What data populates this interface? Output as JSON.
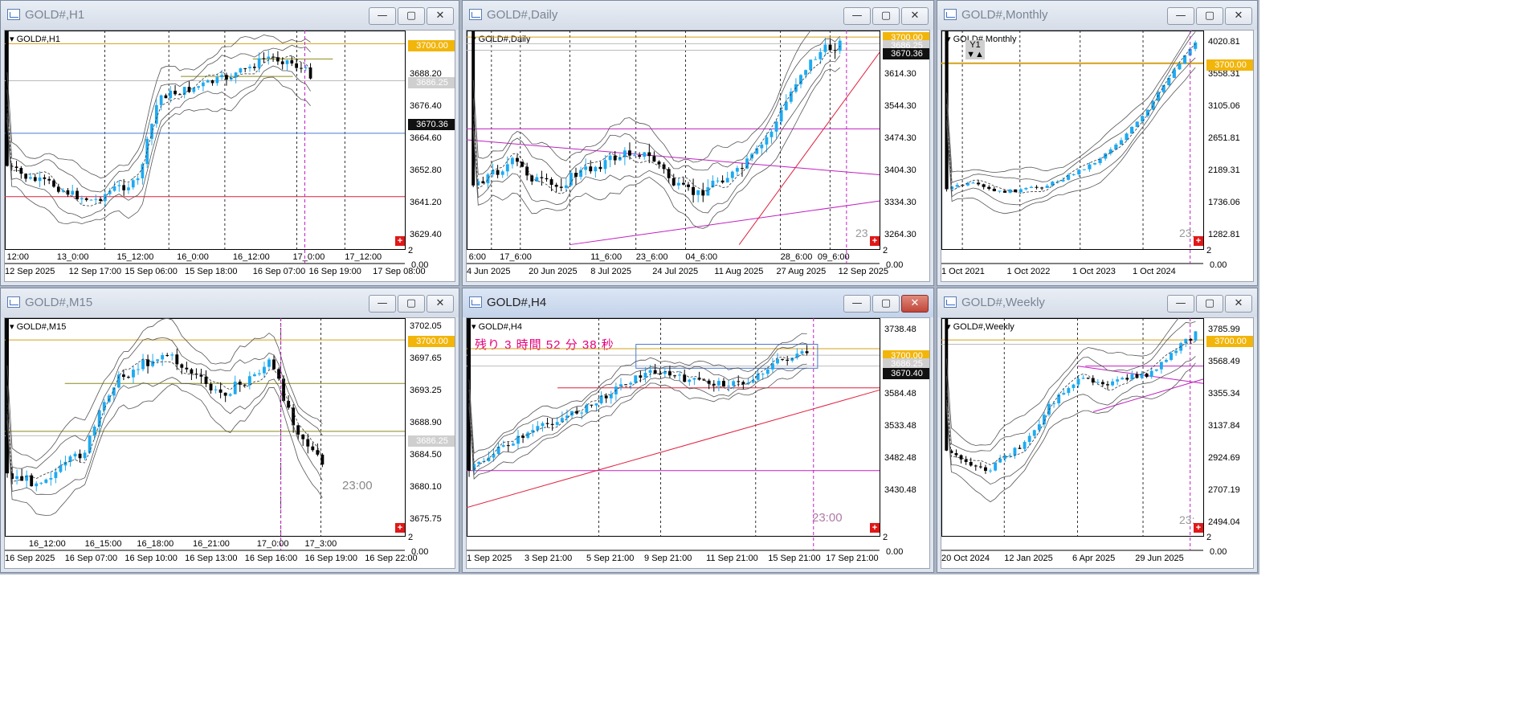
{
  "colors": {
    "gold_line": "#d4a017",
    "blue_line": "#4a7ad0",
    "magenta": "#c020c0",
    "red": "#e0203c",
    "olive": "#8a8a1a",
    "bull": "#1eaaf1",
    "bear": "#000000"
  },
  "windows": {
    "h1": {
      "title": "GOLD#,H1",
      "symbol_label": "GOLD#,H1",
      "price_labels": [
        "3688.20",
        "3676.40",
        "3664.60",
        "3652.80",
        "3641.20",
        "3629.40"
      ],
      "badges": [
        "3700.00",
        "3686.25",
        "3670.36"
      ],
      "scale_corner": "2",
      "scale_zero": "0.00",
      "top_times": [
        "12:00",
        "13_0:00",
        "15_12:00",
        "16_0:00",
        "16_12:00",
        "17_0:00",
        "17_12:00"
      ],
      "bottom_dates": [
        "12 Sep 2025",
        "12 Sep 17:00",
        "15 Sep 06:00",
        "15 Sep 18:00",
        "16 Sep 07:00",
        "16 Sep 19:00",
        "17 Sep 08:00"
      ]
    },
    "daily": {
      "title": "GOLD#,Daily",
      "symbol_label": "GOLD#,Daily",
      "price_labels": [
        "3614.30",
        "3544.30",
        "3474.30",
        "3404.30",
        "3334.30",
        "3264.30"
      ],
      "badges": [
        "3700.00",
        "3686.25",
        "3670.36"
      ],
      "scale_corner": "2",
      "scale_zero": "0.00",
      "timer_stub": "23",
      "top_times": [
        "6:00",
        "17_6:00",
        "11_6:00",
        "23_6:00",
        "04_6:00",
        "28_6:00",
        "09_6:00"
      ],
      "bottom_dates": [
        "4 Jun 2025",
        "20 Jun 2025",
        "8 Jul 2025",
        "24 Jul 2025",
        "11 Aug 2025",
        "27 Aug 2025",
        "12 Sep 2025"
      ]
    },
    "monthly": {
      "title": "GOLD#,Monthly",
      "symbol_label": "GOLD#,Monthly",
      "period_tag": "Y1",
      "arrows": "▼▲",
      "price_labels": [
        "4020.81",
        "3558.31",
        "3105.06",
        "2651.81",
        "2189.31",
        "1736.06",
        "1282.81"
      ],
      "badges": [
        "3700.00"
      ],
      "scale_corner": "2",
      "scale_zero": "0.00",
      "timer_stub": "23:",
      "bottom_dates": [
        "1 Oct 2021",
        "1 Oct 2022",
        "1 Oct 2023",
        "1 Oct 2024"
      ]
    },
    "m15": {
      "title": "GOLD#,M15",
      "symbol_label": "GOLD#,M15",
      "price_labels": [
        "3702.05",
        "3697.65",
        "3693.25",
        "3688.90",
        "3684.50",
        "3680.10",
        "3675.75"
      ],
      "badges": [
        "3700.00",
        "3686.25"
      ],
      "scale_corner": "2",
      "scale_zero": "0.00",
      "timer": "23:00",
      "top_times": [
        "16_12:00",
        "16_15:00",
        "16_18:00",
        "16_21:00",
        "17_0:00",
        "17_3:00"
      ],
      "bottom_dates": [
        "16 Sep 2025",
        "16 Sep 07:00",
        "16 Sep 10:00",
        "16 Sep 13:00",
        "16 Sep 16:00",
        "16 Sep 19:00",
        "16 Sep 22:00"
      ]
    },
    "h4": {
      "title": "GOLD#,H4",
      "symbol_label": "GOLD#,H4",
      "countdown": "残り 3 時間 52 分 38 秒",
      "price_labels": [
        "3738.48",
        "3636.48",
        "3584.48",
        "3533.48",
        "3482.48",
        "3430.48"
      ],
      "badges": [
        "3700.00",
        "3686.25",
        "3670.40"
      ],
      "scale_corner": "2",
      "scale_zero": "0.00",
      "timer": "23:00",
      "bottom_dates": [
        "1 Sep 2025",
        "3 Sep 21:00",
        "5 Sep 21:00",
        "9 Sep 21:00",
        "11 Sep 21:00",
        "15 Sep 21:00",
        "17 Sep 21:00"
      ]
    },
    "weekly": {
      "title": "GOLD#,Weekly",
      "symbol_label": "GOLD#,Weekly",
      "price_labels": [
        "3785.99",
        "3568.49",
        "3355.34",
        "3137.84",
        "2924.69",
        "2707.19",
        "2494.04"
      ],
      "badges": [
        "3700.00"
      ],
      "scale_corner": "2",
      "scale_zero": "0.00",
      "timer_stub": "23:",
      "bottom_dates": [
        "20 Oct 2024",
        "12 Jan 2025",
        "6 Apr 2025",
        "29 Jun 2025"
      ]
    }
  },
  "buttons": {
    "minimize": "—",
    "maximize": "▢",
    "close": "✕"
  }
}
